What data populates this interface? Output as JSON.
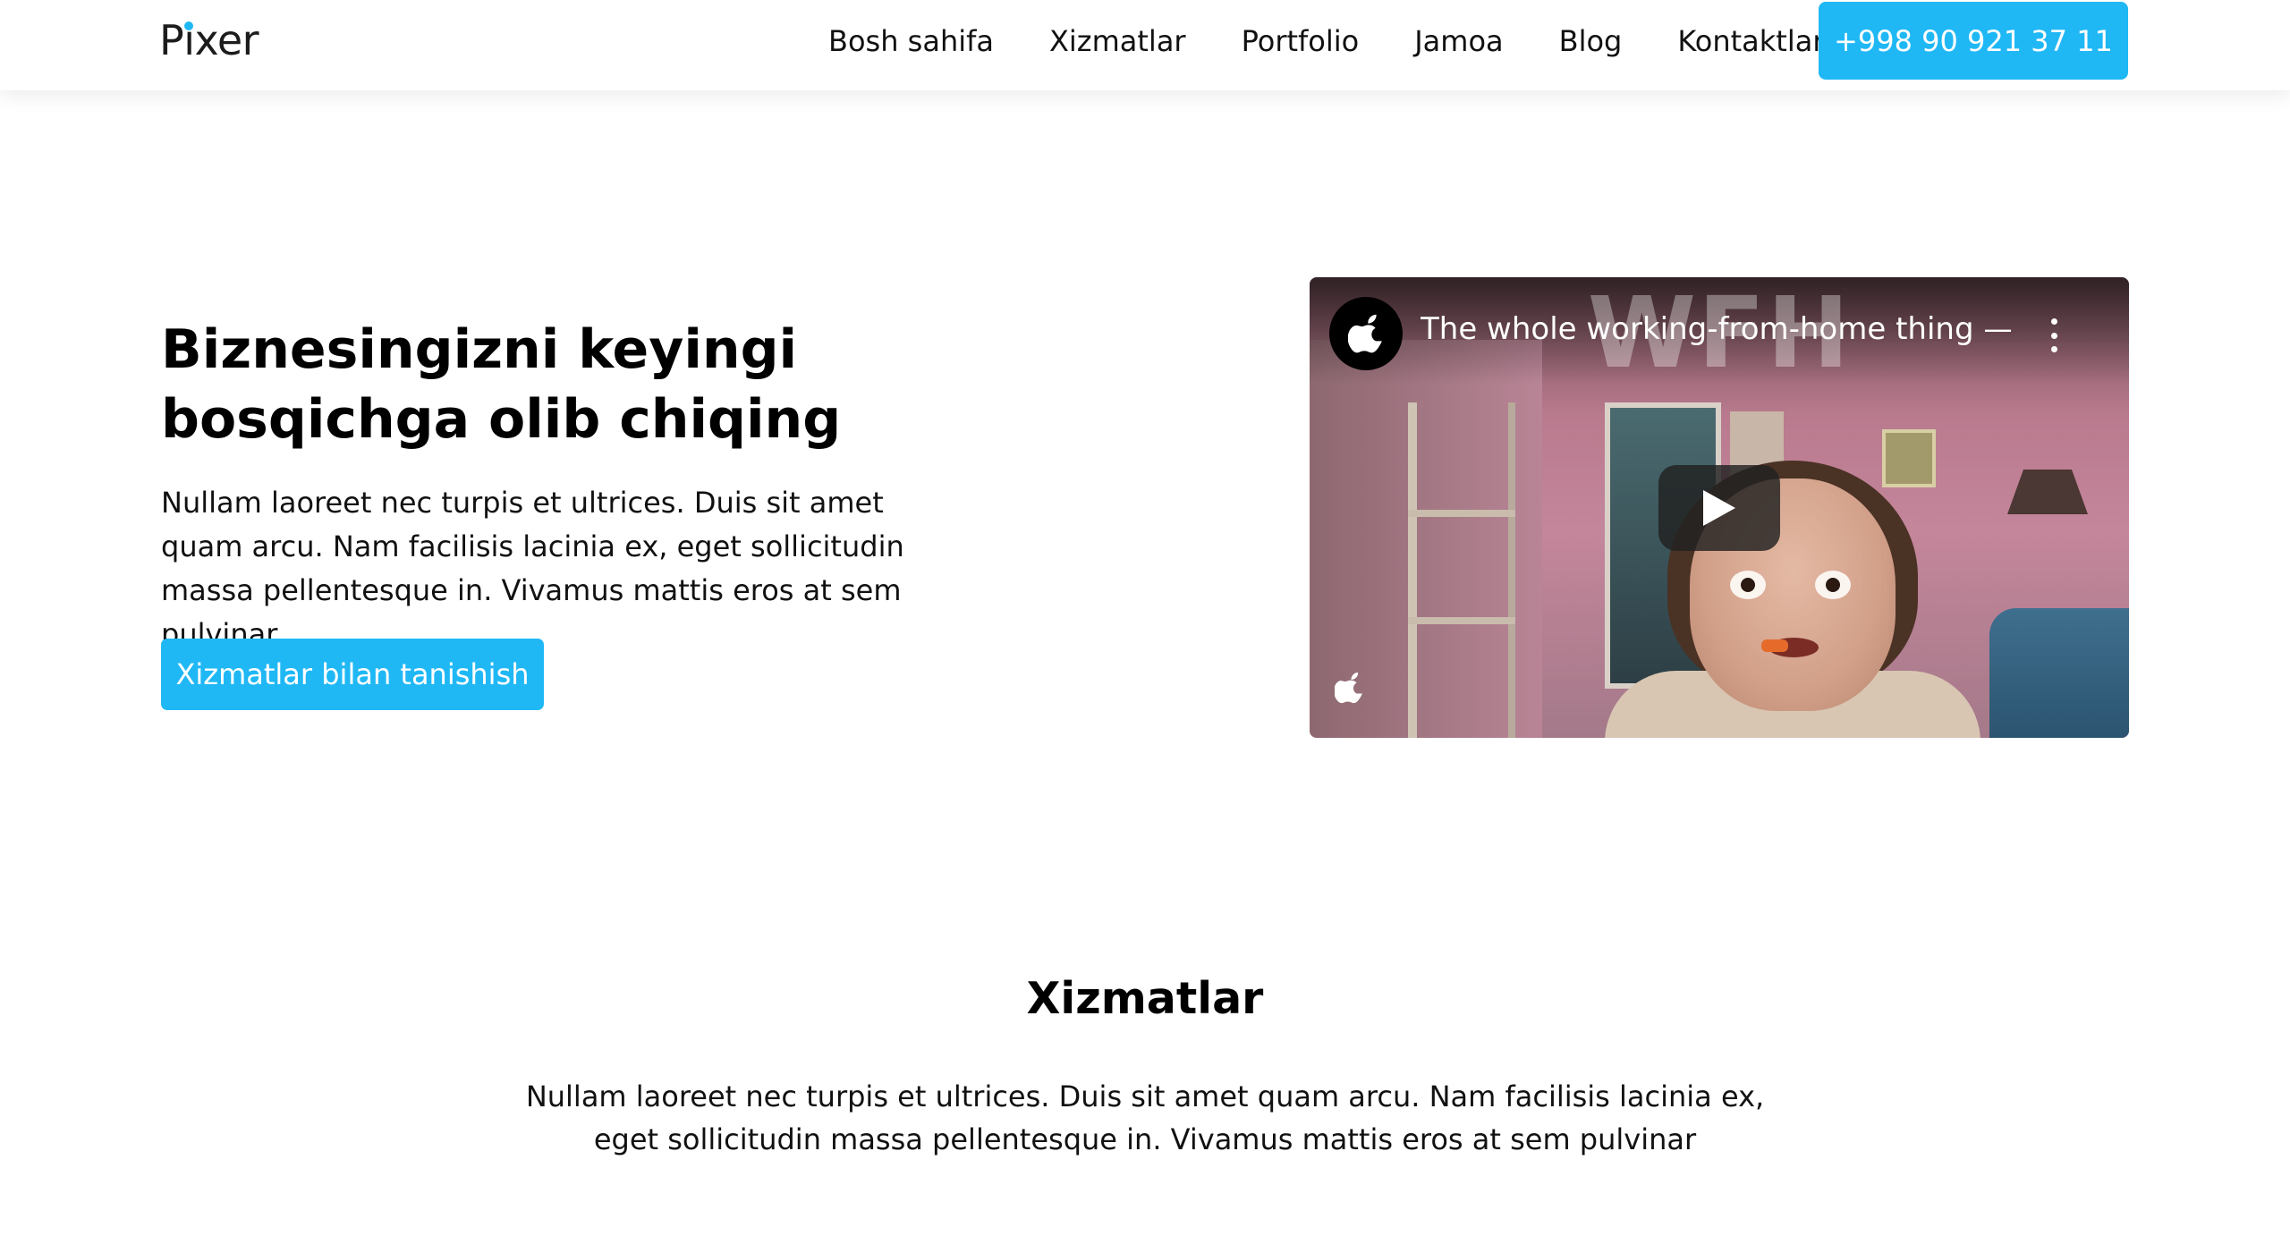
{
  "header": {
    "logo": {
      "before": "P",
      "i": "ı",
      "after": "xer",
      "dot_color": "#1fb8f5"
    },
    "nav": [
      "Bosh sahifa",
      "Xizmatlar",
      "Portfolio",
      "Jamoa",
      "Blog",
      "Kontaktlar"
    ],
    "phone_button": "+998 90 921 37 11"
  },
  "hero": {
    "title": "Biznesingizni keyingi bosqichga olib chiqing",
    "text": "Nullam laoreet nec turpis et ultrices. Duis sit amet quam arcu. Nam facilisis lacinia ex, eget sollicitudin massa pellentesque in. Vivamus mattis eros at sem pulvinar",
    "button": "Xizmatlar bilan tanishish"
  },
  "video": {
    "title": "The whole working-from-home thing — ...",
    "overlay_text": "WFH",
    "channel_icon": "apple-logo-icon",
    "play_icon": "play-icon",
    "menu_icon": "more-vertical-icon",
    "watermark_icon": "apple-logo-icon"
  },
  "services": {
    "title": "Xizmatlar",
    "text": "Nullam laoreet nec turpis et ultrices. Duis sit amet quam arcu. Nam facilisis lacinia ex, eget sollicitudin massa pellentesque in. Vivamus mattis eros at sem pulvinar"
  },
  "colors": {
    "accent": "#1fb8f5",
    "text": "#111111",
    "background": "#ffffff"
  }
}
